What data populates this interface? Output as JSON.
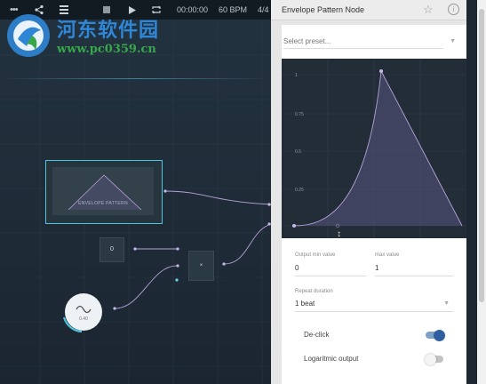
{
  "toolbar": {
    "time": "00:00:00",
    "tempo": "60 BPM",
    "signature": "4/4"
  },
  "watermark": {
    "site_name": "河东软件园",
    "url": "www.pc0359.cn"
  },
  "canvas": {
    "envelope_node_label": "ENVELOPE PATTERN",
    "constant_node_value": "0",
    "multiply_node_symbol": "×",
    "oscillator_value": "0.40"
  },
  "panel": {
    "title": "Envelope Pattern Node",
    "preset_placeholder": "Select preset...",
    "graph": {
      "y_labels": [
        "1",
        "0.75",
        "0.5",
        "0.25"
      ]
    },
    "output_min_label": "Output min value",
    "output_min_value": "0",
    "output_max_label": "max value",
    "output_max_value": "1",
    "repeat_label": "Repeat duration",
    "repeat_value": "1 beat",
    "declick_label": "De-click",
    "declick_on": true,
    "log_label": "Logaritmic output",
    "log_on": false
  },
  "colors": {
    "accent": "#4fc3d9",
    "toggle_on": "#2f5f9e",
    "curve": "#b7a3d8"
  },
  "icons": [
    "share-icon",
    "list-icon",
    "stop-icon",
    "play-icon",
    "loop-icon",
    "star-icon",
    "info-icon",
    "sine-wave-icon",
    "resize-cursor-icon"
  ]
}
